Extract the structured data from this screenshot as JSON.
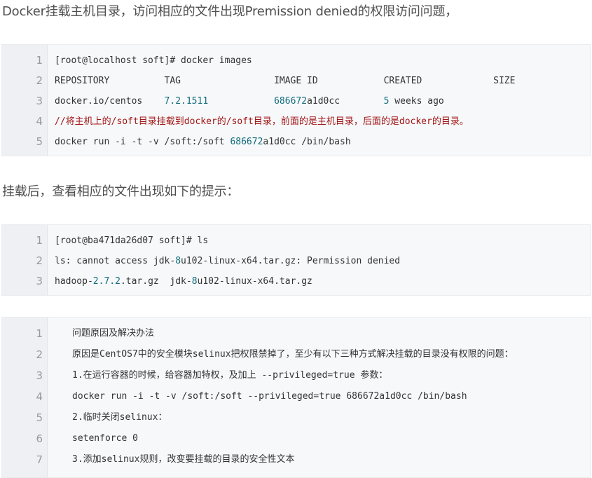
{
  "heading1": "Docker挂载主机目录，访问相应的文件出现Premission denied的权限访问问题，",
  "heading2": "挂载后，查看相应的文件出现如下的提示：",
  "block1": [
    {
      "n": "1",
      "parts": [
        {
          "t": "[root@localhost soft]# docker images",
          "c": ""
        }
      ]
    },
    {
      "n": "2",
      "parts": [
        {
          "t": "REPOSITORY          TAG                 IMAGE ID            CREATED             SIZE",
          "c": ""
        }
      ]
    },
    {
      "n": "3",
      "parts": [
        {
          "t": "docker.io/centos    ",
          "c": ""
        },
        {
          "t": "7.2.1511",
          "c": "num"
        },
        {
          "t": "            ",
          "c": ""
        },
        {
          "t": "686672",
          "c": "num"
        },
        {
          "t": "a1d0cc        ",
          "c": ""
        },
        {
          "t": "5",
          "c": "num"
        },
        {
          "t": " weeks ago",
          "c": ""
        }
      ]
    },
    {
      "n": "4",
      "parts": [
        {
          "t": "//将主机上的/soft目录挂载到docker的/soft目录，前面的是主机目录，后面的是docker的目录。",
          "c": "cmt"
        }
      ]
    },
    {
      "n": "5",
      "parts": [
        {
          "t": "docker run -i -t -v /soft:/soft ",
          "c": ""
        },
        {
          "t": "686672",
          "c": "num"
        },
        {
          "t": "a1d0cc /bin/bash",
          "c": ""
        }
      ]
    }
  ],
  "block2": [
    {
      "n": "1",
      "parts": [
        {
          "t": "[root@ba471da26d07 soft]# ls",
          "c": ""
        }
      ]
    },
    {
      "n": "2",
      "parts": [
        {
          "t": "ls: cannot access jdk-",
          "c": ""
        },
        {
          "t": "8",
          "c": "num"
        },
        {
          "t": "u102-linux-x64.tar.gz: Permission denied",
          "c": ""
        }
      ]
    },
    {
      "n": "3",
      "parts": [
        {
          "t": "hadoop-",
          "c": ""
        },
        {
          "t": "2.7.2",
          "c": "num"
        },
        {
          "t": ".tar.gz  jdk-",
          "c": ""
        },
        {
          "t": "8",
          "c": "num"
        },
        {
          "t": "u102-linux-x64.tar.gz",
          "c": ""
        }
      ]
    }
  ],
  "block3": [
    {
      "n": "1",
      "parts": [
        {
          "t": "问题原因及解决办法",
          "c": ""
        }
      ]
    },
    {
      "n": "2",
      "parts": [
        {
          "t": "原因是CentOS7中的安全模块selinux把权限禁掉了，至少有以下三种方式解决挂载的目录没有权限的问题：",
          "c": ""
        }
      ]
    },
    {
      "n": "3",
      "parts": [
        {
          "t": "1.在运行容器的时候，给容器加特权，及加上 --privileged=true 参数：",
          "c": ""
        }
      ]
    },
    {
      "n": "4",
      "parts": [
        {
          "t": "docker run -i -t -v /soft:/soft --privileged=true 686672a1d0cc /bin/bash",
          "c": ""
        }
      ]
    },
    {
      "n": "5",
      "parts": [
        {
          "t": "2.临时关闭selinux：",
          "c": ""
        }
      ]
    },
    {
      "n": "6",
      "parts": [
        {
          "t": "setenforce 0",
          "c": ""
        }
      ]
    },
    {
      "n": "7",
      "parts": [
        {
          "t": "3.添加selinux规则，改变要挂载的目录的安全性文本",
          "c": ""
        }
      ]
    }
  ]
}
